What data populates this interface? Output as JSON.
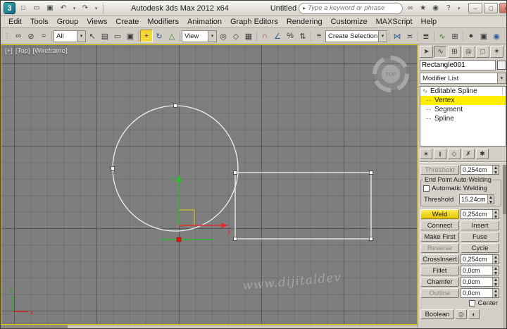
{
  "titlebar": {
    "app_title": "Autodesk 3ds Max  2012 x64",
    "doc_title": "Untitled",
    "search_placeholder": "Type a keyword or phrase"
  },
  "menus": [
    "Edit",
    "Tools",
    "Group",
    "Views",
    "Create",
    "Modifiers",
    "Animation",
    "Graph Editors",
    "Rendering",
    "Customize",
    "MAXScript",
    "Help"
  ],
  "toolbar": {
    "filter_value": "All",
    "coord_value": "View",
    "selset_value": "Create Selection Se"
  },
  "viewport": {
    "label_plus": "[+]",
    "label_view": "[Top]",
    "label_shading": "[Wireframe]",
    "viewcube_text": "TOP",
    "watermark": "www.dijitaldev",
    "axis_x": "x",
    "axis_y": "y"
  },
  "panel": {
    "object_name": "Rectangle001",
    "modifier_list": "Modifier List",
    "stack_root": "Editable Spline",
    "stack_items": [
      "Vertex",
      "Segment",
      "Spline"
    ],
    "rollout": {
      "threshold_top_label": "Threshold",
      "threshold_top_value": "0,254cm",
      "autoweld_group": "End Point Auto-Welding",
      "autoweld_checkbox": "Automatic Welding",
      "threshold_label": "Threshold",
      "threshold_value": "15,24cm",
      "weld": "Weld",
      "weld_value": "0,254cm",
      "connect": "Connect",
      "insert": "Insert",
      "make_first": "Make First",
      "fuse": "Fuse",
      "reverse": "Reverse",
      "cycle": "Cycle",
      "crossinsert": "CrossInsert",
      "crossinsert_value": "0,254cm",
      "fillet": "Fillet",
      "fillet_value": "0,0cm",
      "chamfer": "Chamfer",
      "chamfer_value": "0,0cm",
      "outline": "Outline",
      "outline_value": "0,0cm",
      "center_checkbox": "Center",
      "boolean": "Boolean"
    }
  },
  "colors": {
    "selection_highlight": "#ffee00",
    "active_tool": "#f5d73a",
    "viewport_border": "#d9c400",
    "axis_x": "#e03030",
    "axis_y": "#22c522",
    "spline": "#f0f0f0"
  },
  "icons": {
    "app_logo": "3",
    "new": "□",
    "open": "▭",
    "save": "▣",
    "undo": "↶",
    "redo": "↷",
    "caret": "▾",
    "search_go": "▸",
    "binoculars": "∞",
    "star": "★",
    "comm": "◉",
    "help": "?",
    "min": "–",
    "max": "□",
    "close": "×",
    "handle": "⋮",
    "link": "∞",
    "unlink": "⊘",
    "bindsw": "≈",
    "selobj": "↖",
    "selname": "▤",
    "region": "▭",
    "wincross": "▣",
    "move": "+",
    "rotate": "↻",
    "scale": "△",
    "center": "◎",
    "manip": "◇",
    "kbd": "▦",
    "snap3": "∩",
    "snapang": "∠",
    "snappct": "%",
    "snapspin": "⇅",
    "namedsel": "≡",
    "mirror": "⋈",
    "align": "≍",
    "layers": "≣",
    "curve": "∿",
    "schem": "⊞",
    "rsetup": "●",
    "rframe": "▣",
    "render": "◉",
    "tab_create": "➤",
    "tab_modify": "∿",
    "tab_hier": "⊞",
    "tab_motion": "◎",
    "tab_display": "□",
    "tab_util": "✶",
    "spline": "∿",
    "stackdots": "┆",
    "pin": "∗",
    "endres": "‖",
    "unique": "◇",
    "remove": "✗",
    "config": "✱",
    "bool_a": "◎",
    "bool_b": "◐"
  }
}
